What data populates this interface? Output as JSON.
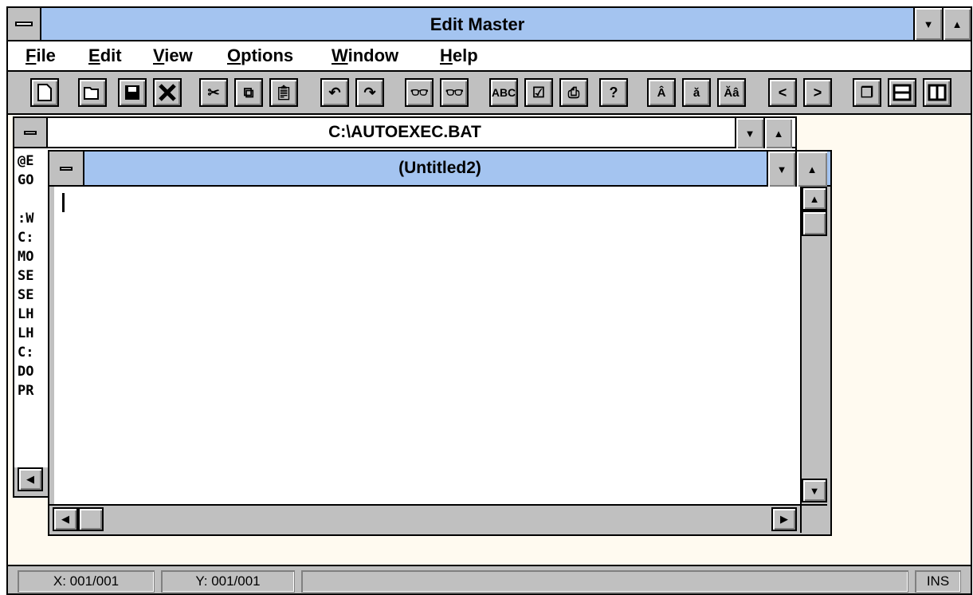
{
  "app": {
    "title": "Edit Master"
  },
  "menu": [
    "File",
    "Edit",
    "View",
    "Options",
    "Window",
    "Help"
  ],
  "toolbar_icons": [
    "new-icon",
    "open-icon",
    "save-icon",
    "close-icon",
    "cut-icon",
    "copy-icon",
    "paste-icon",
    "undo-icon",
    "redo-icon",
    "find-icon",
    "find-next-icon",
    "spellcheck-icon",
    "properties-icon",
    "print-icon",
    "help-icon",
    "uppercase-icon",
    "lowercase-icon",
    "toggle-case-icon",
    "prev-icon",
    "next-icon",
    "cascade-icon",
    "tile-horizontal-icon",
    "tile-vertical-icon"
  ],
  "doc1": {
    "title": "C:\\AUTOEXEC.BAT",
    "lines": [
      "@E",
      "GO",
      "",
      ":W",
      "C:",
      "MO",
      "SE",
      "SE",
      "LH",
      "LH",
      "C:",
      "DO",
      "PR"
    ]
  },
  "doc2": {
    "title": "(Untitled2)"
  },
  "status": {
    "x": "X: 001/001",
    "y": "Y: 001/001",
    "mode": "INS"
  },
  "colors": {
    "titlebar": "#a4c4f0",
    "background": "#fffaf0",
    "face": "#c0c0c0"
  }
}
